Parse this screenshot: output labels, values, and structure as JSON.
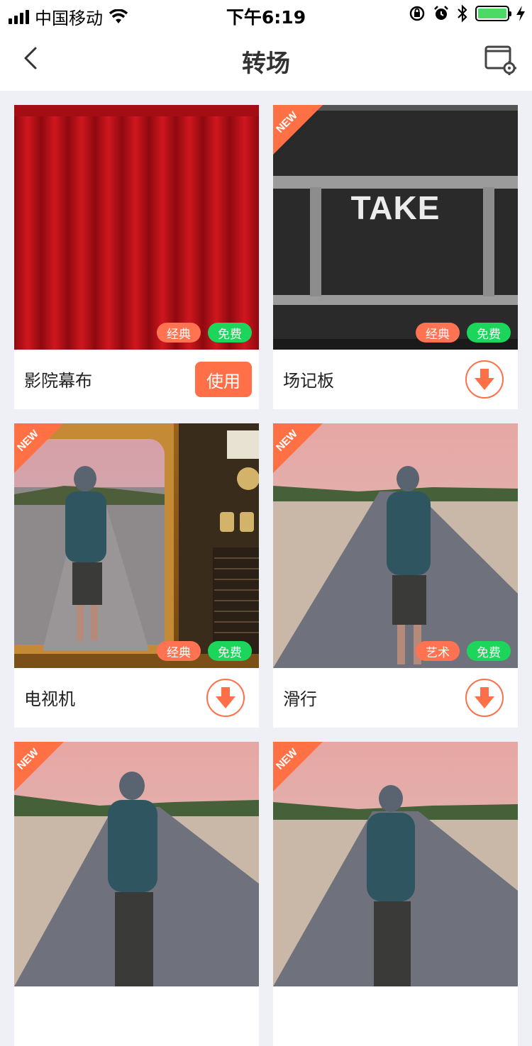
{
  "status_bar": {
    "carrier": "中国移动",
    "time": "下午6:19"
  },
  "nav": {
    "title": "转场"
  },
  "colors": {
    "accent": "#ff6f48",
    "free_badge": "#1bd65b",
    "page_bg": "#eff0f5"
  },
  "cards": [
    {
      "name": "影院幕布",
      "new": "",
      "category": "经典",
      "price": "免费",
      "action": "使用",
      "thumb": "curtain"
    },
    {
      "name": "场记板",
      "new": "NEW",
      "category": "经典",
      "price": "免费",
      "action": "download",
      "thumb": "clapperboard",
      "thumb_text": "TAKE"
    },
    {
      "name": "电视机",
      "new": "NEW",
      "category": "经典",
      "price": "免费",
      "action": "download",
      "thumb": "tv"
    },
    {
      "name": "滑行",
      "new": "NEW",
      "category": "艺术",
      "price": "免费",
      "action": "download",
      "thumb": "road"
    },
    {
      "name": "",
      "new": "NEW",
      "category": "",
      "price": "",
      "action": "",
      "thumb": "road"
    },
    {
      "name": "",
      "new": "NEW",
      "category": "",
      "price": "",
      "action": "",
      "thumb": "road"
    }
  ]
}
